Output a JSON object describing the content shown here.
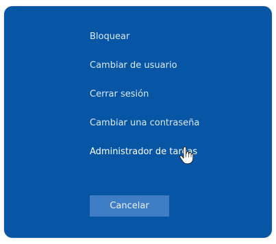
{
  "menu": {
    "items": [
      {
        "label": "Bloquear"
      },
      {
        "label": "Cambiar de usuario"
      },
      {
        "label": "Cerrar sesión"
      },
      {
        "label": "Cambiar una contraseña"
      },
      {
        "label": "Administrador de tareas"
      }
    ]
  },
  "cancel_label": "Cancelar",
  "colors": {
    "background": "#0756a6",
    "button": "#3f7dc4",
    "text": "#dce9f7"
  },
  "icons": {
    "cursor": "hand-pointer-icon"
  }
}
